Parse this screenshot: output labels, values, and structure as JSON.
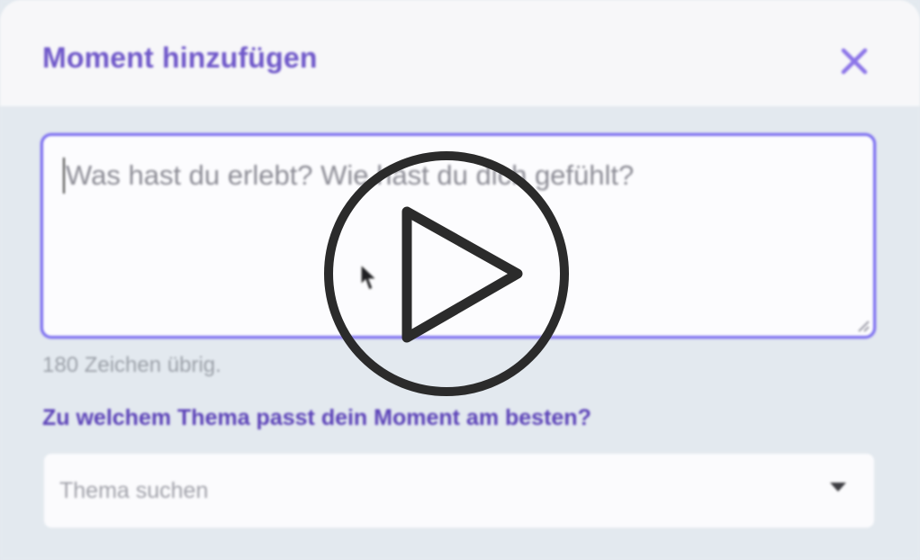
{
  "modal": {
    "title": "Moment hinzufügen",
    "close_icon": "close-icon"
  },
  "moment_input": {
    "placeholder": "Was hast du erlebt? Wie hast du dich gefühlt?",
    "counter": "180 Zeichen übrig."
  },
  "topic": {
    "question": "Zu welchem Thema passt dein Moment am besten?",
    "placeholder": "Thema suchen",
    "dropdown_icon": "caret-down-icon"
  },
  "video_overlay": {
    "icon": "play-icon"
  },
  "colors": {
    "accent": "#7a6df0",
    "title": "#6f58c9",
    "question": "#5c43b8",
    "background": "#e3e9ef",
    "header": "#f7f7f9",
    "overlay": "#2b2b2b"
  }
}
